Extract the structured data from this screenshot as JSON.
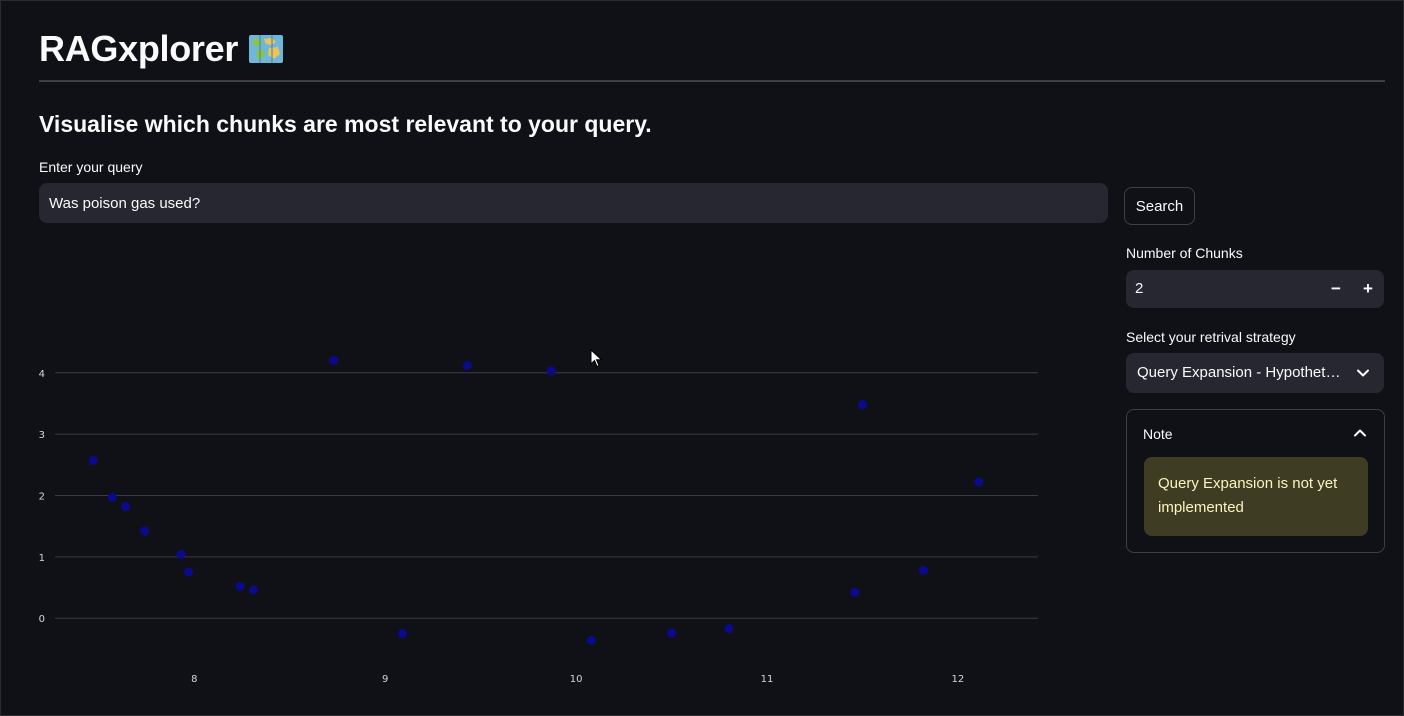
{
  "header": {
    "title": "RAGxplorer",
    "title_icon": "world-map-icon",
    "subtitle": "Visualise which chunks are most relevant to your query."
  },
  "query": {
    "label": "Enter your query",
    "value": "Was poison gas used?",
    "search_label": "Search"
  },
  "chunks": {
    "label": "Number of Chunks",
    "value": "2",
    "minus_label": "−",
    "plus_label": "+"
  },
  "strategy": {
    "label": "Select your retrival strategy",
    "selected": "Query Expansion - Hypothetical Answer"
  },
  "note": {
    "title": "Note",
    "message": "Query Expansion is not yet implemented"
  },
  "colors": {
    "background": "#0f1117",
    "point": "#0a0a8c",
    "grid": "#3a3a44",
    "alert_bg": "#3e3c23",
    "alert_text": "#fbf3c1"
  },
  "chart_data": {
    "type": "scatter",
    "title": "",
    "xlabel": "",
    "ylabel": "",
    "xlim": [
      7.27,
      12.42
    ],
    "ylim": [
      -0.6,
      4.6
    ],
    "xticks": [
      8,
      9,
      10,
      11,
      12
    ],
    "yticks": [
      0,
      1,
      2,
      3,
      4
    ],
    "grid": "horizontal",
    "points": [
      {
        "x": 7.47,
        "y": 2.57
      },
      {
        "x": 7.57,
        "y": 1.97
      },
      {
        "x": 7.64,
        "y": 1.82
      },
      {
        "x": 7.74,
        "y": 1.42
      },
      {
        "x": 7.93,
        "y": 1.04
      },
      {
        "x": 7.97,
        "y": 0.75
      },
      {
        "x": 8.24,
        "y": 0.52
      },
      {
        "x": 8.31,
        "y": 0.46
      },
      {
        "x": 8.73,
        "y": 4.2
      },
      {
        "x": 9.09,
        "y": -0.25
      },
      {
        "x": 9.43,
        "y": 4.12
      },
      {
        "x": 9.87,
        "y": 4.03
      },
      {
        "x": 10.08,
        "y": -0.36
      },
      {
        "x": 10.5,
        "y": -0.24
      },
      {
        "x": 10.8,
        "y": -0.17
      },
      {
        "x": 11.46,
        "y": 0.42
      },
      {
        "x": 11.5,
        "y": 3.48
      },
      {
        "x": 11.82,
        "y": 0.78
      },
      {
        "x": 12.11,
        "y": 2.22
      }
    ]
  }
}
